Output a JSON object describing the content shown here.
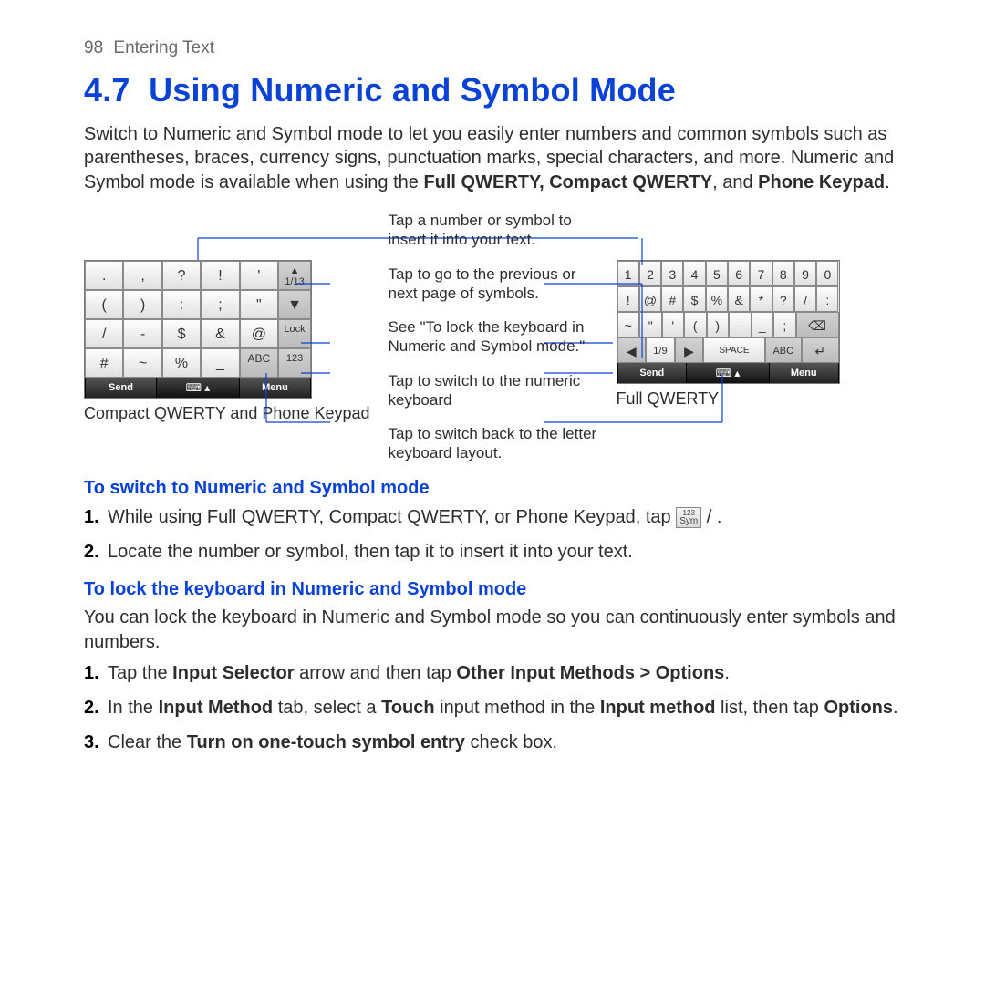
{
  "page_number": "98",
  "breadcrumb": "Entering Text",
  "section_number": "4.7",
  "section_title": "Using Numeric and Symbol Mode",
  "intro_before_bold": "Switch to Numeric and Symbol mode to let you easily enter numbers and common symbols such as parentheses, braces, currency signs, punctuation marks, special characters, and more. Numeric and Symbol mode is available when using the ",
  "intro_bold": "Full QWERTY, Compact QWERTY",
  "intro_mid": ", and ",
  "intro_bold2": "Phone Keypad",
  "intro_end": ".",
  "captions": {
    "c1": "Tap a number or symbol to insert it into your text.",
    "c2": "Tap to go to the previous or next page of symbols.",
    "c3": "See \"To lock the keyboard in Numeric and Symbol mode.\"",
    "c4": "Tap to switch to the numeric keyboard",
    "c5": "Tap to switch back to the letter keyboard layout."
  },
  "compact_label": "Compact QWERTY and Phone Keypad",
  "full_label": "Full QWERTY",
  "compact_keys": {
    "r1": [
      ".",
      ",",
      "?",
      "!",
      "'"
    ],
    "r1_side_top": "▲",
    "r1_side_mid": "1/13",
    "r2": [
      "(",
      ")",
      ":",
      ";",
      "\""
    ],
    "r2_side": "▼",
    "r3": [
      "/",
      "-",
      "$",
      "&",
      "@"
    ],
    "r3_side": "Lock",
    "r4": [
      "#",
      "~",
      "%",
      "_",
      "ABC"
    ],
    "r4_side": "123",
    "b_left": "Send",
    "b_mid": "⌨ ▴",
    "b_right": "Menu"
  },
  "full_keys": {
    "r1": [
      "1",
      "2",
      "3",
      "4",
      "5",
      "6",
      "7",
      "8",
      "9",
      "0"
    ],
    "r2": [
      "!",
      "@",
      "#",
      "$",
      "%",
      "&",
      "*",
      "?",
      "/",
      ":"
    ],
    "r3": [
      "~",
      "\"",
      "'",
      "(",
      ")",
      "-",
      "_",
      ";",
      "⌫"
    ],
    "r4_left": "◀",
    "r4_page": "1/9",
    "r4_right": "▶",
    "r4_space": "SPACE",
    "r4_abc": "ABC",
    "r4_enter": "↵",
    "b_left": "Send",
    "b_mid": "⌨ ▴",
    "b_right": "Menu"
  },
  "sub1_title": "To switch to Numeric and Symbol mode",
  "sub1_step1_a": "While using Full QWERTY, Compact QWERTY, or Phone Keypad, tap ",
  "sub1_step1_key_top": "123",
  "sub1_step1_key_bot": "Sym",
  "sub1_step1_b": " /        .",
  "sub1_step2": "Locate the number or symbol, then tap it to insert it into your text.",
  "sub2_title": "To lock the keyboard in Numeric and Symbol mode",
  "sub2_intro": "You can lock the keyboard in Numeric and Symbol mode so you can continuously enter symbols and numbers.",
  "sub2_step1_a": "Tap the ",
  "sub2_step1_b1": "Input Selector",
  "sub2_step1_c": " arrow and then tap ",
  "sub2_step1_b2": "Other Input Methods > Options",
  "sub2_step1_d": ".",
  "sub2_step2_a": "In the ",
  "sub2_step2_b1": "Input Method",
  "sub2_step2_c": " tab, select a ",
  "sub2_step2_b2": "Touch",
  "sub2_step2_d": " input method in the ",
  "sub2_step2_b3": "Input method",
  "sub2_step2_e": " list, then tap ",
  "sub2_step2_b4": "Options",
  "sub2_step2_f": ".",
  "sub2_step3_a": "Clear the ",
  "sub2_step3_b": "Turn on one-touch symbol entry",
  "sub2_step3_c": " check box.",
  "nums": {
    "n1": "1.",
    "n2": "2.",
    "n3": "3."
  }
}
